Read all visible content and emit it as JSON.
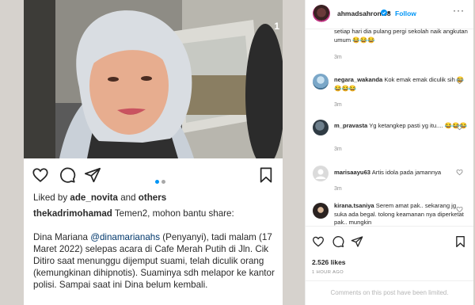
{
  "left_post": {
    "carousel_counter": "1",
    "liked_by_prefix": "Liked by ",
    "liked_by_user": "ade_novita",
    "liked_by_and": " and ",
    "liked_by_others": "others",
    "caption_user": "thekadrimohamad",
    "caption_intro": "Temen2, mohon bantu share:",
    "body_before_mention": "Dina Mariana ",
    "body_mention": "@dinamarianahs",
    "body_after_mention": " (Penyanyi), tadi malam (17 Maret 2022) selepas acara di Cafe Merah Putih di Jln. Cik Ditiro saat menunggu dijemput suami,  telah diculik orang (kemungkinan dihipnotis). Suaminya sdh melapor ke kantor polisi. Sampai saat ini Dina belum kembali."
  },
  "right_post": {
    "username": "ahmadsahroni88",
    "dot": "•",
    "follow_label": "Follow",
    "more": "···",
    "comments": [
      {
        "user": "",
        "text": "setiap hari dia pulang pergi sekolah naik angkutan umum 😂😂😂",
        "time": "3m"
      },
      {
        "user": "negara_wakanda",
        "text": "Kok emak emak diculik sih 😂😂😂😂",
        "time": "3m"
      },
      {
        "user": "m_pravasta",
        "text": "Yg ketangkep pasti yg itu.... 😂😂😂",
        "time": "3m"
      },
      {
        "user": "marisaayu63",
        "text": "Artis idola pada jamannya",
        "time": "3m"
      },
      {
        "user": "kirana.tsaniya",
        "text": "Serem amat pak.. sekarang jg suka ada begal. tolong keamanan nya diperketat pak.. mungkin",
        "time": ""
      }
    ],
    "likes_count": "2.526 likes",
    "time_ago": "1 HOUR AGO",
    "comments_limited": "Comments on this post have been limited."
  },
  "colors": {
    "follow_blue": "#0095f6",
    "mention_blue": "#00376b",
    "carousel_active_dot": "#0095f6",
    "carousel_inactive_dot": "#a8a8a8",
    "page_background": "#d6d2cd"
  }
}
